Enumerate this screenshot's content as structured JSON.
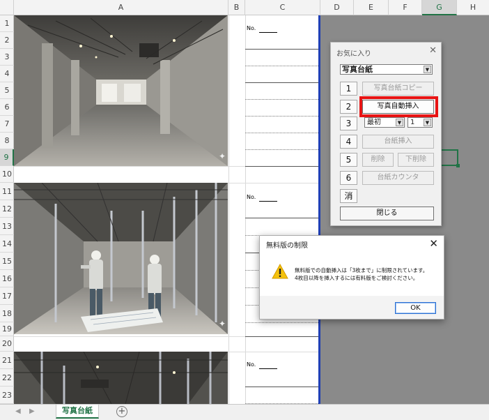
{
  "columns": [
    "A",
    "B",
    "C",
    "D",
    "E",
    "F",
    "G",
    "H"
  ],
  "selected_column": "G",
  "rows": [
    "1",
    "2",
    "3",
    "4",
    "5",
    "6",
    "7",
    "8",
    "9",
    "10",
    "11",
    "12",
    "13",
    "14",
    "15",
    "16",
    "17",
    "18",
    "19",
    "20",
    "21",
    "22",
    "23"
  ],
  "selected_row": "9",
  "photo_pages": [
    {
      "no_label": "No.",
      "photo": "empty-concrete-floor-photo"
    },
    {
      "no_label": "No.",
      "photo": "workers-installing-studs-photo"
    },
    {
      "no_label": "No.",
      "photo": "construction-ceiling-photo"
    }
  ],
  "sheet_tab": "写真台紙",
  "favorites_panel": {
    "title": "お気に入り",
    "close": "✕",
    "template_select": "写真台紙",
    "buttons": [
      {
        "num": "1",
        "label": "写真台紙コピー",
        "enabled": false
      },
      {
        "num": "2",
        "label": "写真自動挿入",
        "enabled": true,
        "highlighted": true
      },
      {
        "num": "3",
        "position": "最初",
        "count": "1"
      },
      {
        "num": "4",
        "label": "台紙挿入",
        "enabled": false
      },
      {
        "num": "5",
        "label": "削除",
        "label2": "下削除",
        "enabled": false
      },
      {
        "num": "6",
        "label": "台紙カウンタ",
        "enabled": false
      },
      {
        "num": "消"
      }
    ],
    "close_button": "閉じる"
  },
  "dialog": {
    "title": "無料版の制限",
    "close": "✕",
    "icon": "warning-icon",
    "message_line1": "無料版での自動挿入は「3枚まで」に制限されています。",
    "message_line2": "4枚目以降を挿入するには有料版をご検討ください。",
    "ok_button": "OK"
  },
  "colors": {
    "excel_green": "#217346",
    "highlight_red": "#e81414",
    "print_border_blue": "#1f3fb5"
  }
}
